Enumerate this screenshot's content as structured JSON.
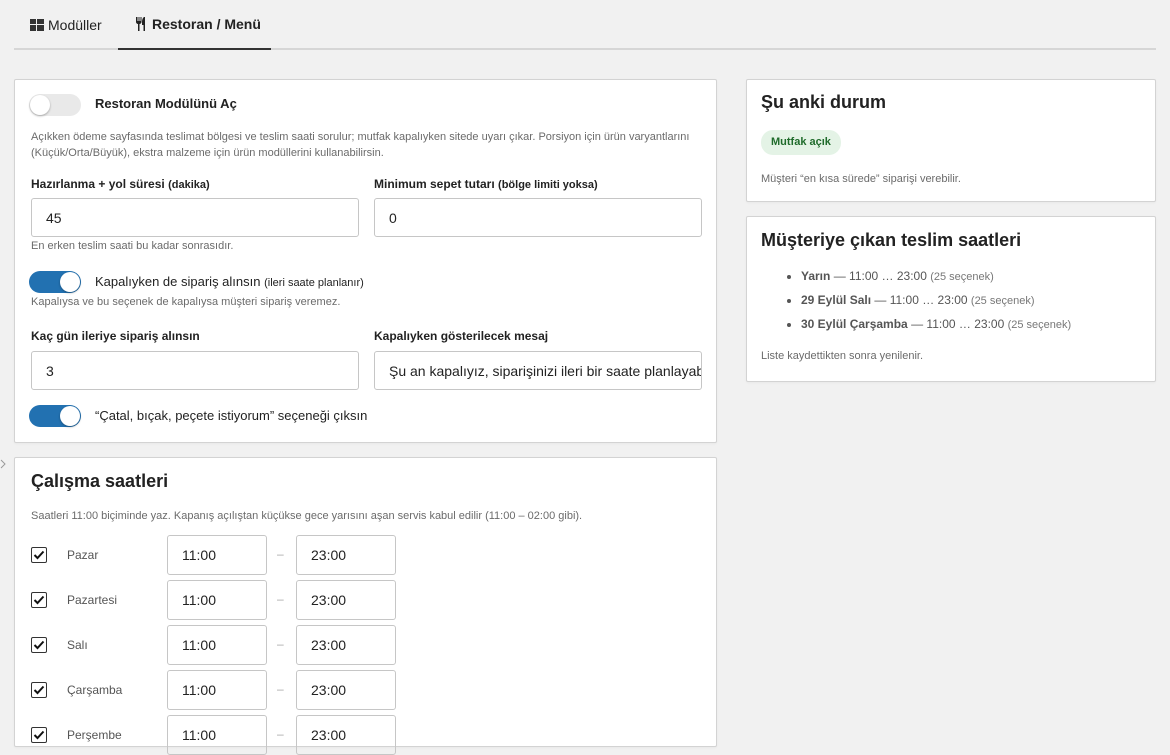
{
  "tabs": [
    {
      "label": "Modüller",
      "icon": "grid-icon",
      "active": false
    },
    {
      "label": "Restoran / Menü",
      "icon": "fork-knife-icon",
      "active": true
    }
  ],
  "main": {
    "module_toggle_label": "Restoran Modülünü Aç",
    "module_enabled": false,
    "module_help": "Açıkken ödeme sayfasında teslimat bölgesi ve teslim saati sorulur; mutfak kapalıyken sitede uyarı çıkar. Porsiyon için ürün varyantlarını (Küçük/Orta/Büyük), ekstra malzeme için ürün modüllerini kullanabilirsin.",
    "prep_label": "Hazırlanma + yol süresi",
    "prep_unit": "(dakika)",
    "prep_value": "45",
    "prep_help": "En erken teslim saati bu kadar sonrasıdır.",
    "min_basket_label": "Minimum sepet tutarı",
    "min_basket_note": "(bölge limiti yoksa)",
    "min_basket_value": "0",
    "closed_orders_label": "Kapalıyken de sipariş alınsın",
    "closed_orders_note": "(ileri saate planlanır)",
    "closed_orders_enabled": true,
    "closed_orders_help": "Kapalıysa ve bu seçenek de kapalıysa müşteri sipariş veremez.",
    "days_ahead_label": "Kaç gün ileriye sipariş alınsın",
    "days_ahead_value": "3",
    "closed_message_label": "Kapalıyken gösterilecek mesaj",
    "closed_message_value": "Şu an kapalıyız, siparişinizi ileri bir saate planlayabilirsiniz.",
    "cutlery_label": "“Çatal, bıçak, peçete istiyorum” seçeneği çıksın",
    "cutlery_enabled": true
  },
  "hours": {
    "title": "Çalışma saatleri",
    "help": "Saatleri 11:00 biçiminde yaz. Kapanış açılıştan küçükse gece yarısını aşan servis kabul edilir (11:00 – 02:00 gibi).",
    "separator": "–",
    "days": [
      {
        "name": "Pazar",
        "checked": true,
        "open": "11:00",
        "close": "23:00"
      },
      {
        "name": "Pazartesi",
        "checked": true,
        "open": "11:00",
        "close": "23:00"
      },
      {
        "name": "Salı",
        "checked": true,
        "open": "11:00",
        "close": "23:00"
      },
      {
        "name": "Çarşamba",
        "checked": true,
        "open": "11:00",
        "close": "23:00"
      },
      {
        "name": "Perşembe",
        "checked": true,
        "open": "11:00",
        "close": "23:00"
      }
    ]
  },
  "status": {
    "title": "Şu anki durum",
    "badge": "Mutfak açık",
    "badge_color": "#1f6b2b",
    "note": "Müşteri “en kısa sürede” siparişi verebilir."
  },
  "delivery": {
    "title": "Müşteriye çıkan teslim saatleri",
    "slots": [
      {
        "day": "Yarın",
        "range": "— 11:00 … 23:00",
        "count": "(25 seçenek)"
      },
      {
        "day": "29 Eylül Salı",
        "range": "— 11:00 … 23:00",
        "count": "(25 seçenek)"
      },
      {
        "day": "30 Eylül Çarşamba",
        "range": "— 11:00 … 23:00",
        "count": "(25 seçenek)"
      }
    ],
    "note": "Liste kaydettikten sonra yenilenir."
  },
  "colors": {
    "accent": "#2271b1",
    "toggle_off": "#e9e9e9"
  }
}
